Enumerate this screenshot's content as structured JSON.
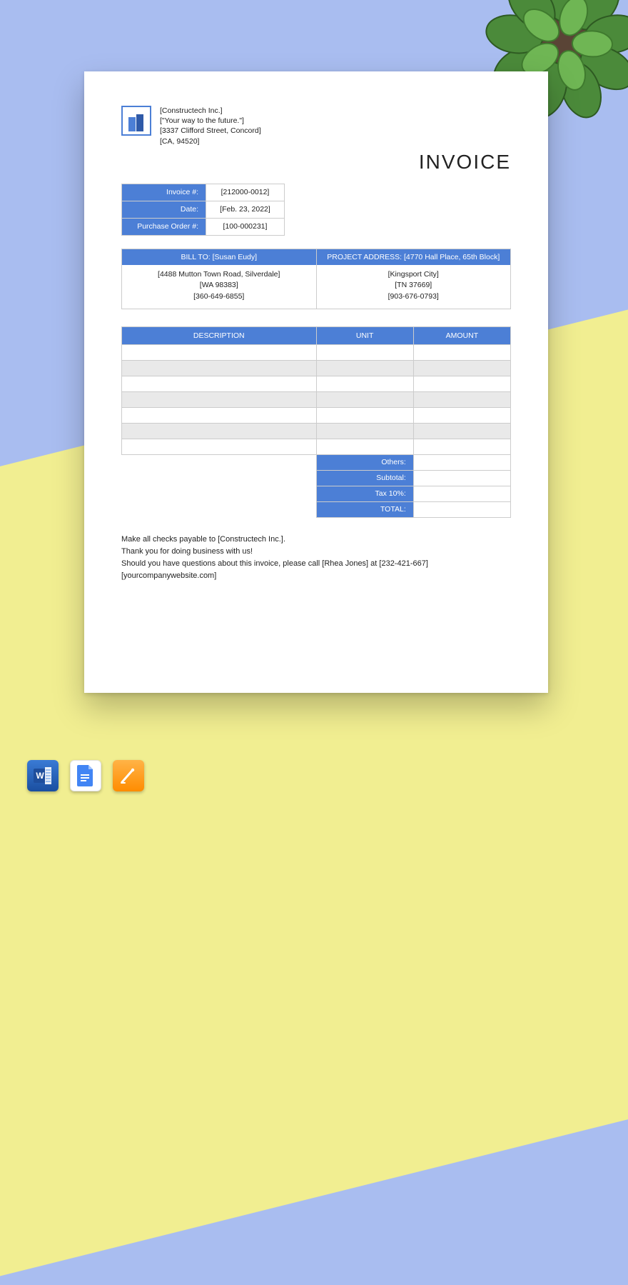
{
  "company": {
    "name": "[Constructech Inc.]",
    "tagline": "[\"Your way to the future.\"]",
    "street": "[3337  Clifford Street, Concord]",
    "region": "[CA, 94520]"
  },
  "title": "INVOICE",
  "meta": {
    "invoice_label": "Invoice #:",
    "invoice_value": "[212000-0012]",
    "date_label": "Date:",
    "date_value": "[Feb. 23, 2022]",
    "po_label": "Purchase Order #:",
    "po_value": "[100-000231]"
  },
  "bill_to": {
    "header": "BILL TO: [Susan Eudy]",
    "line1": "[4488 Mutton Town Road, Silverdale]",
    "line2": "[WA 98383]",
    "line3": "[360-649-6855]"
  },
  "project": {
    "header": "PROJECT ADDRESS: [4770  Hall Place, 65th Block]",
    "line1": "[Kingsport City]",
    "line2": "[TN 37669]",
    "line3": "[903-676-0793]"
  },
  "columns": {
    "desc": "DESCRIPTION",
    "unit": "UNIT",
    "amount": "AMOUNT"
  },
  "totals": {
    "others": "Others:",
    "subtotal": "Subtotal:",
    "tax": "Tax 10%:",
    "total": "TOTAL:"
  },
  "footer": {
    "l1": "Make all checks payable to [Constructech Inc.].",
    "l2": "Thank you for doing business with us!",
    "l3": "Should you have questions about this invoice, please call [Rhea Jones] at [232-421-667]",
    "l4": "[yourcompanywebsite.com]"
  },
  "icons": {
    "word": "word-icon",
    "gdoc": "google-docs-icon",
    "pages": "apple-pages-icon"
  }
}
